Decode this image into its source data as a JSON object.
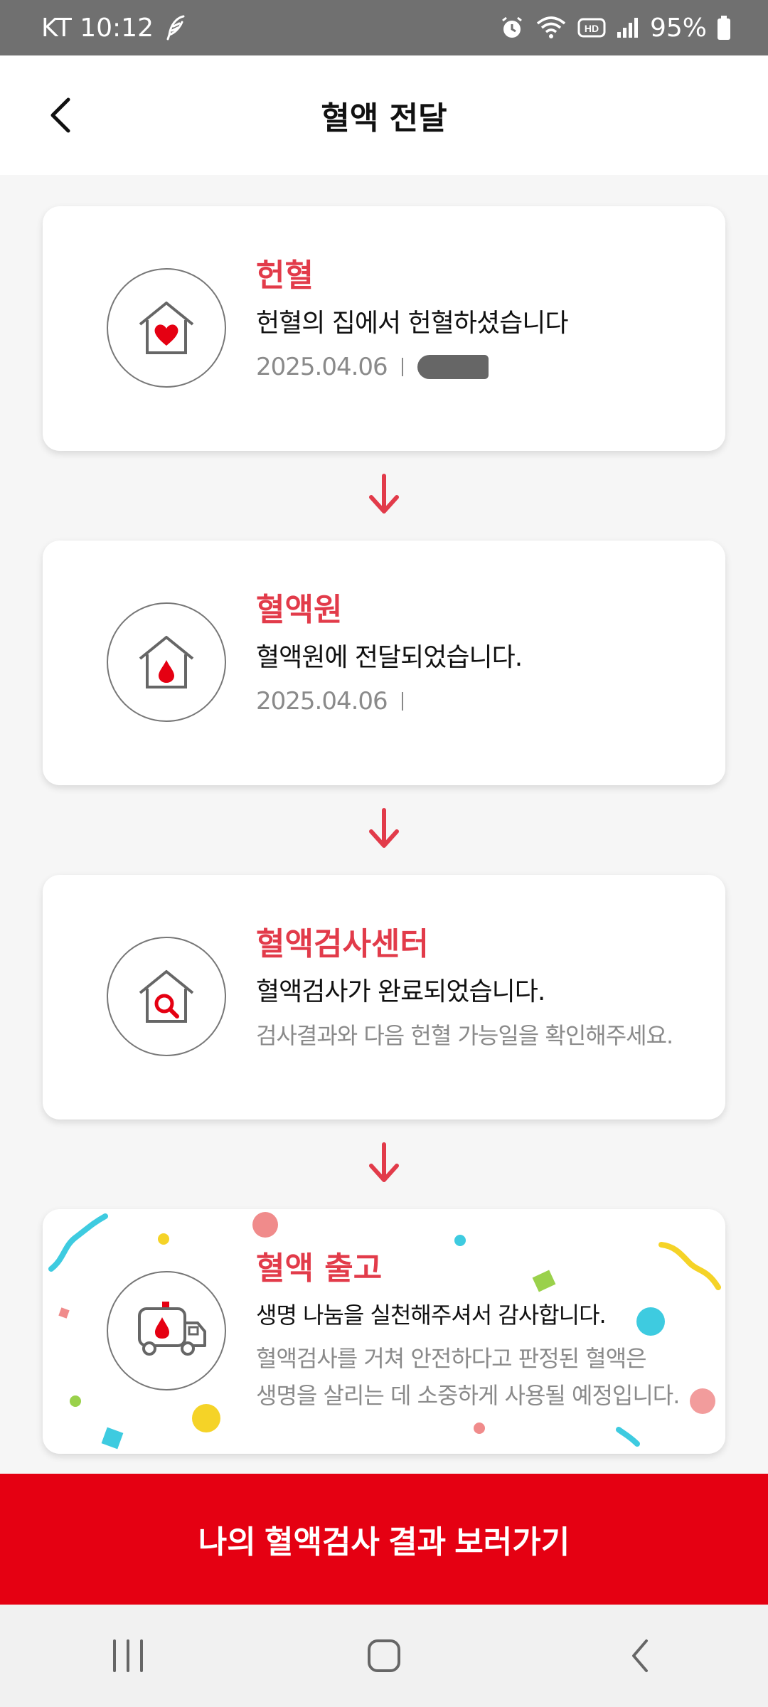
{
  "status_bar": {
    "carrier_time": "KT 10:12",
    "battery": "95%",
    "icons": [
      "feather-icon",
      "alarm-icon",
      "wifi-icon",
      "hd-icon",
      "signal-icon",
      "battery-icon"
    ]
  },
  "header": {
    "title": "혈액 전달",
    "back_icon": "chevron-left-icon"
  },
  "steps": [
    {
      "title": "헌혈",
      "desc": "헌혈의 집에서 헌혈하셨습니다",
      "date": "2025.04.06",
      "icon": "house-heart-icon"
    },
    {
      "title": "혈액원",
      "desc": "혈액원에 전달되었습니다.",
      "date": "2025.04.06",
      "icon": "house-drop-icon"
    },
    {
      "title": "혈액검사센터",
      "desc": "혈액검사가 완료되었습니다.",
      "sub": "검사결과와 다음 헌혈 가능일을 확인해주세요.",
      "icon": "house-search-icon"
    },
    {
      "title": "혈액 출고",
      "desc": "생명 나눔을 실천해주셔서 감사합니다.",
      "sub1": "혈액검사를 거쳐 안전하다고 판정된 혈액은",
      "sub2": "생명을 살리는 데 소중하게 사용될 예정입니다.",
      "icon": "delivery-truck-icon"
    }
  ],
  "cta": {
    "label": "나의 혈액검사 결과 보러가기"
  },
  "nav_bar": {
    "items": [
      "recent-apps-icon",
      "home-icon",
      "back-icon"
    ]
  },
  "colors": {
    "accent": "#e23b4a",
    "cta": "#e50012",
    "status_bar": "#707070"
  }
}
